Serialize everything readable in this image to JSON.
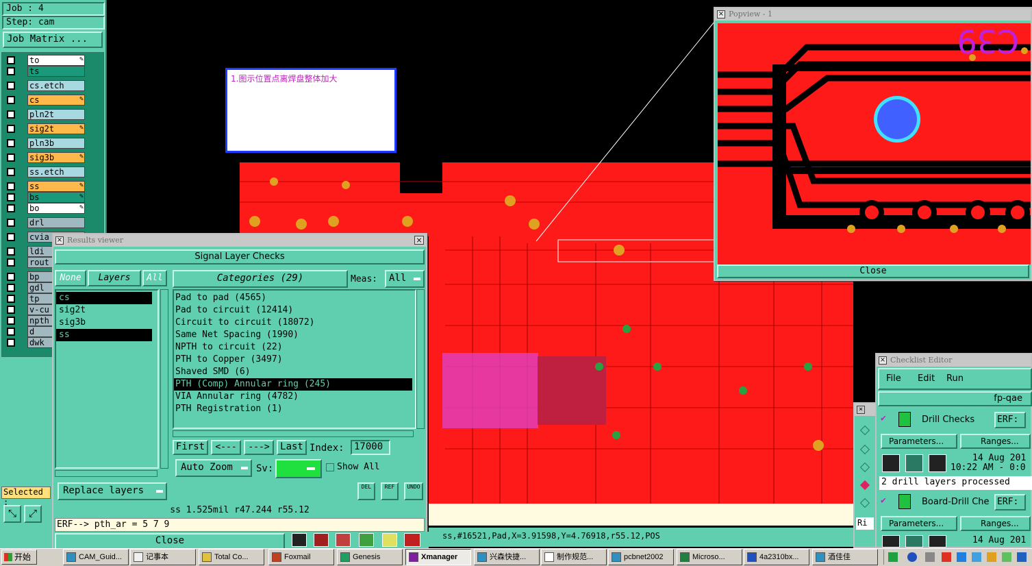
{
  "left_panel": {
    "job": "Job : 4",
    "step": "Step: cam",
    "job_matrix": "Job Matrix ...",
    "layers": [
      {
        "name": "to",
        "color": "#ffffff",
        "mark": "edit"
      },
      {
        "name": "ts",
        "color": "#1a9a7a",
        "mark": ""
      },
      {
        "name": "cs.etch",
        "color": "#a8d8e0",
        "mark": ""
      },
      {
        "name": "cs",
        "color": "#ffb84a",
        "mark": "edit"
      },
      {
        "name": "pln2t",
        "color": "#a8d8e0",
        "mark": ""
      },
      {
        "name": "sig2t",
        "color": "#ffb84a",
        "mark": "edit"
      },
      {
        "name": "pln3b",
        "color": "#a8d8e0",
        "mark": ""
      },
      {
        "name": "sig3b",
        "color": "#ffb84a",
        "mark": "edit"
      },
      {
        "name": "ss.etch",
        "color": "#a8d8e0",
        "mark": ""
      },
      {
        "name": "ss",
        "color": "#ffb84a",
        "mark": "edit"
      },
      {
        "name": "bs",
        "color": "#1a9a7a",
        "mark": "edit"
      },
      {
        "name": "bo",
        "color": "#ffffff",
        "mark": "edit"
      },
      {
        "name": "drl",
        "color": "#a0b8c0",
        "mark": ""
      },
      {
        "name": "cvia",
        "color": "#a0b8c0",
        "mark": ""
      },
      {
        "name": "ldi",
        "color": "#a0b8c0",
        "mark": ""
      },
      {
        "name": "rout",
        "color": "#a0b8c0",
        "mark": ""
      },
      {
        "name": "bp",
        "color": "#a0b8c0",
        "mark": ""
      },
      {
        "name": "gdl",
        "color": "#a0b8c0",
        "mark": ""
      },
      {
        "name": "tp",
        "color": "#a0b8c0",
        "mark": ""
      },
      {
        "name": "v-cu",
        "color": "#a0b8c0",
        "mark": ""
      },
      {
        "name": "npth",
        "color": "#a0b8c0",
        "mark": ""
      },
      {
        "name": "d",
        "color": "#a0b8c0",
        "mark": ""
      },
      {
        "name": "dwk",
        "color": "#a0b8c0",
        "mark": ""
      }
    ],
    "selected_label": "Selected :"
  },
  "note": {
    "text": "1.图示位置点离焊盘整体加大"
  },
  "results_viewer": {
    "title": "Results viewer",
    "subtitle": "Signal Layer Checks",
    "none_btn": "None",
    "layers_btn": "Layers",
    "all_btn": "All",
    "layers": [
      "cs",
      "sig2t",
      "sig3b",
      "ss"
    ],
    "categories_label": "Categories (29)",
    "meas_label": "Meas:",
    "meas_value": "All",
    "categories": [
      "Pad to pad (4565)",
      "Pad to circuit (12414)",
      "Circuit to circuit (18072)",
      "Same Net Spacing (1990)",
      "NPTH to circuit (22)",
      "PTH to Copper (3497)",
      "Shaved SMD (6)",
      "PTH (Comp) Annular ring (245)",
      "VIA Annular ring (4782)",
      "PTH Registration (1)"
    ],
    "selected_category_index": 7,
    "first_btn": "First",
    "prev_btn": "<---",
    "next_btn": "--->",
    "last_btn": "Last",
    "index_label": "Index:",
    "index_value": "17000",
    "auto_zoom": "Auto Zoom",
    "sv_label": "Sv:",
    "show_all": "Show All",
    "replace_layers": "Replace layers",
    "del_btn": "DEL",
    "ref_btn": "REF",
    "undo_btn": "UNDO",
    "status": "ss 1.525mil  r47.244  r55.12",
    "erf_line": "ERF--> pth_ar = 5 7 9",
    "close_btn": "Close"
  },
  "popview": {
    "title": "Popview - 1",
    "close_btn": "Close",
    "label_text": "C39"
  },
  "checklist": {
    "title": "Checklist Editor",
    "menu": [
      "File",
      "Edit",
      "Run"
    ],
    "name": "fp-qae",
    "items": [
      {
        "label": "Drill Checks",
        "erf": "ERF:",
        "params": "Parameters...",
        "ranges": "Ranges...",
        "date": "14 Aug 201",
        "time": "10:22 AM - 0:0",
        "result": "2 drill layers processed"
      },
      {
        "label": "Board-Drill Che",
        "erf": "ERF:",
        "params": "Parameters...",
        "ranges": "Ranges...",
        "date": "14 Aug 201",
        "time": "",
        "result": ""
      }
    ]
  },
  "coord_bar": "ss,#16521,Pad,X=3.91598,Y=4.76918,r55.12,POS",
  "side_panel_label": "Ri",
  "taskbar": {
    "start": "开始",
    "items": [
      {
        "label": "CAM_Guid...",
        "icon": "app-icon"
      },
      {
        "label": "记事本",
        "icon": "notepad-icon"
      },
      {
        "label": "Total Co...",
        "icon": "folder-icon"
      },
      {
        "label": "Foxmail",
        "icon": "mail-icon"
      },
      {
        "label": "Genesis",
        "icon": "genesis-icon"
      },
      {
        "label": "Xmanager",
        "icon": "xmanager-icon",
        "active": true
      },
      {
        "label": "兴森快捷...",
        "icon": "app-icon"
      },
      {
        "label": "制作规范...",
        "icon": "doc-icon"
      },
      {
        "label": "pcbnet2002",
        "icon": "app-icon"
      },
      {
        "label": "Microso...",
        "icon": "excel-icon"
      },
      {
        "label": "4a2310bx...",
        "icon": "word-icon"
      },
      {
        "label": "酒佳佳",
        "icon": "app-icon"
      }
    ]
  },
  "colors": {
    "panel": "#5fcfb0",
    "copper": "#ff1a1a",
    "accent_yellow": "#fffbe0",
    "selection": "#000000"
  }
}
